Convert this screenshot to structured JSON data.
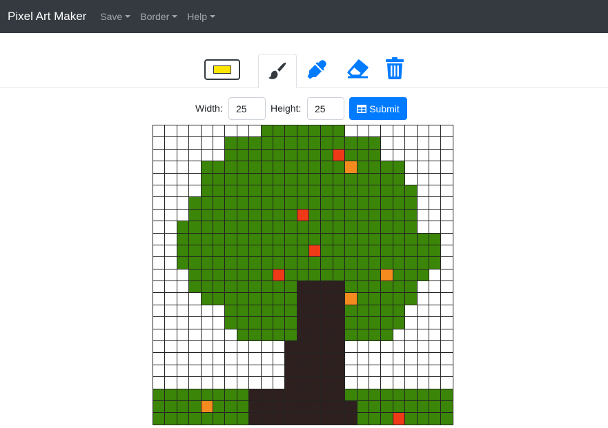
{
  "navbar": {
    "brand": "Pixel Art Maker",
    "menus": [
      {
        "label": "Save"
      },
      {
        "label": "Border"
      },
      {
        "label": "Help"
      }
    ]
  },
  "tools": {
    "current_color": "#ffe600",
    "active_tool": "brush",
    "accent_color": "#007bff",
    "brush_color": "#343a40",
    "items": [
      {
        "name": "color-picker",
        "icon": "color-swatch-icon"
      },
      {
        "name": "brush",
        "icon": "paint-brush-icon"
      },
      {
        "name": "eyedropper",
        "icon": "eyedropper-icon"
      },
      {
        "name": "eraser",
        "icon": "eraser-icon"
      },
      {
        "name": "clear",
        "icon": "trash-icon"
      }
    ]
  },
  "size_form": {
    "width_label": "Width:",
    "width_value": "25",
    "height_label": "Height:",
    "height_value": "25",
    "submit_label": "Submit",
    "submit_icon": "table-icon"
  },
  "canvas": {
    "rows": 25,
    "cols": 25,
    "palette": {
      ".": "#ffffff",
      "G": "#3b8509",
      "B": "#2f2020",
      "R": "#f03a17",
      "O": "#f58a1f"
    },
    "pixels": [
      ".........GGGGGGG.........",
      "......GGGGGGGGGGGGG......",
      "......GGGGGGGGGRGGG......",
      "....GGGGGGGGGGGGOGGGG....",
      "....GGGGGGGGGGGGGGGGG....",
      "....GGGGGGGGGGGGGGGGGG...",
      "...GGGGGGGGGGGGGGGGGGG...",
      "...GGGGGGGGGRGGGGGGGGG...",
      "..GGGGGGGGGGGGGGGGGGGG...",
      "..GGGGGGGGGGGGGGGGGGGGGG.",
      "..GGGGGGGGGGGRGGGGGGGGGG.",
      "..GGGGGGGGGGGGGGGGGGGGGG.",
      "...GGGGGGGRGGGGGGGGOGGG..",
      "...GGGGGGGGGBBBBGGGGGG...",
      "....GGGGGGGGBBBBOGGGGG...",
      "......GGGGGGBBBBGGGGG....",
      "......GGGGGGBBBBGGGGG....",
      ".......GGGGGBBBBGGGG.....",
      "...........BBBBB.........",
      "...........BBBBB.........",
      "...........BBBBB.........",
      "...........BBBBB.........",
      "GGGGGGGGBBBBBBBBGGGGGGGGG",
      "GGGGOGGGBBBBBBBBBGGGGGGGG",
      "GGGGGGGGBBBBBBBBBGGGRGGGG"
    ]
  }
}
